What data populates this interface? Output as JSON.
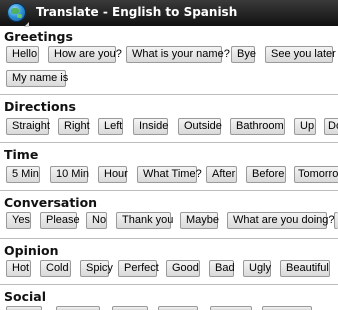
{
  "app": {
    "title": "Translate - English to Spanish"
  },
  "sections": [
    {
      "title": "Greetings",
      "buttons": [
        "Hello",
        "How are you?",
        "What is your name?",
        "Bye",
        "See you later",
        "My name is"
      ]
    },
    {
      "title": "Directions",
      "buttons": [
        "Straight",
        "Right",
        "Left",
        "Inside",
        "Outside",
        "Bathroom",
        "Up",
        "Do"
      ]
    },
    {
      "title": "Time",
      "buttons": [
        "5 Min",
        "10 Min",
        "Hour",
        "What Time?",
        "After",
        "Before",
        "Tomorrow"
      ]
    },
    {
      "title": "Conversation",
      "buttons": [
        "Yes",
        "Please",
        "No",
        "Thank you",
        "Maybe",
        "What are you doing?",
        ""
      ]
    },
    {
      "title": "Opinion",
      "buttons": [
        "Hot",
        "Cold",
        "Spicy",
        "Perfect",
        "Good",
        "Bad",
        "Ugly",
        "Beautiful"
      ]
    },
    {
      "title": "Social",
      "buttons": []
    }
  ]
}
